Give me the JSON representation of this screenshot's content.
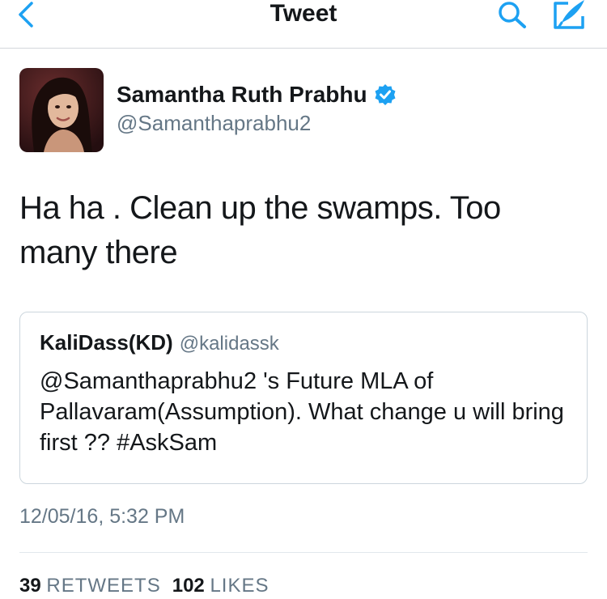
{
  "nav": {
    "title": "Tweet"
  },
  "tweet": {
    "author": {
      "name": "Samantha Ruth Prabhu",
      "handle": "@Samanthaprabhu2",
      "verified": true
    },
    "text": "Ha ha . Clean up the swamps. Too many there",
    "timestamp": "12/05/16, 5:32 PM",
    "stats": {
      "retweets": "39",
      "retweets_label": "RETWEETS",
      "likes": "102",
      "likes_label": "LIKES"
    }
  },
  "quoted_tweet": {
    "name": "KaliDass(KD)",
    "handle": "@kalidassk",
    "text": "@Samanthaprabhu2 's Future MLA of Pallavaram(Assumption). What change u will bring first ?? #AskSam"
  },
  "colors": {
    "accent": "#1da1f2",
    "secondary_text": "#657786",
    "border": "#ccd6dd"
  }
}
